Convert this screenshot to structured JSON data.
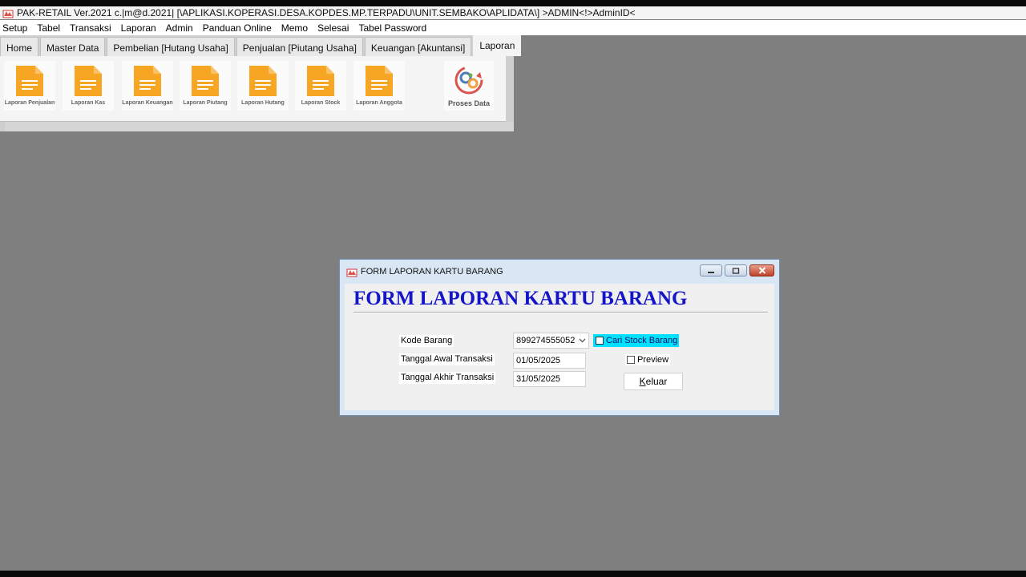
{
  "app": {
    "title": "PAK-RETAIL Ver.2021 c.|m@d.2021| [\\APLIKASI.KOPERASI.DESA.KOPDES.MP.TERPADU\\UNIT.SEMBAKO\\APLIDATA\\] >ADMIN<!>AdminID<"
  },
  "menu": [
    "Setup",
    "Tabel",
    "Transaksi",
    "Laporan",
    "Admin",
    "Panduan Online",
    "Memo",
    "Selesai",
    "Tabel Password"
  ],
  "ribbon": {
    "tabs": [
      "Home",
      "Master Data",
      "Pembelian [Hutang Usaha]",
      "Penjualan [Piutang Usaha]",
      "Keuangan [Akuntansi]",
      "Laporan"
    ],
    "active_tab": "Laporan",
    "buttons": [
      "Laporan Penjualan",
      "Laporan Kas",
      "Laporan Keuangan",
      "Laporan Piutang",
      "Laporan Hutang",
      "Laporan Stock",
      "Laporan Anggota"
    ],
    "proses_label": "Proses Data",
    "doc_color": "#f6a623"
  },
  "dialog": {
    "title": "FORM LAPORAN KARTU BARANG",
    "heading": "FORM LAPORAN KARTU BARANG",
    "heading_color": "#1414c8",
    "fields": {
      "kode_label": "Kode Barang",
      "kode_value": "899274555052",
      "awal_label": "Tanggal Awal Transaksi",
      "awal_value": "01/05/2025",
      "akhir_label": "Tanggal Akhir Transaksi",
      "akhir_value": "31/05/2025"
    },
    "cari_label": "Cari Stock Barang",
    "cari_color": "#00e1ff",
    "preview_label": "Preview",
    "keluar_label": "Keluar",
    "keluar_mnemonic": "K",
    "keluar_rest": "eluar"
  }
}
